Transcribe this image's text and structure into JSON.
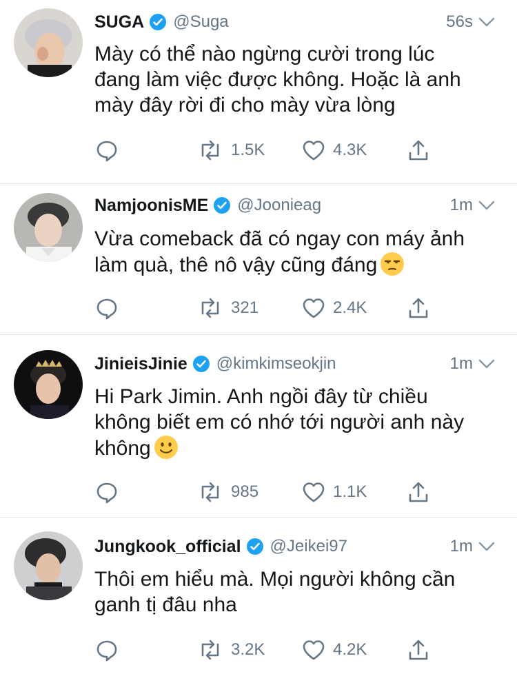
{
  "colors": {
    "text": "#14171a",
    "muted": "#657786",
    "verified": "#1da1f2",
    "divider": "#e1e8ed",
    "icon": "#657786"
  },
  "tweets": [
    {
      "name": "SUGA",
      "handle": "@Suga",
      "time": "56s",
      "lines": [
        "Mày có thể nào ngừng cười trong lúc",
        "đang làm việc được không. Hoặc là anh",
        "mày đây rời đi cho mày vừa lòng"
      ],
      "emoji": "",
      "retweets": "1.5K",
      "likes": "4.3K"
    },
    {
      "name": "NamjoonisME",
      "handle": "@Joonieag",
      "time": "1m",
      "lines": [
        "Vừa comeback đã có ngay con máy ảnh",
        "làm quà, thê nô vậy cũng đáng"
      ],
      "emoji": "unamused-face",
      "retweets": "321",
      "likes": "2.4K"
    },
    {
      "name": "JinieisJinie",
      "handle": "@kimkimseokjin",
      "time": "1m",
      "lines": [
        "Hi Park Jimin. Anh ngồi đây từ chiều",
        "không biết em có nhớ tới người anh này",
        "không"
      ],
      "emoji": "slightly-smiling-face",
      "retweets": "985",
      "likes": "1.1K"
    },
    {
      "name": "Jungkook_official",
      "handle": "@Jeikei97",
      "time": "1m",
      "lines": [
        "Thôi em hiểu mà. Mọi người không cần",
        "ganh tị đâu nha"
      ],
      "emoji": "",
      "retweets": "3.2K",
      "likes": "4.2K"
    }
  ]
}
